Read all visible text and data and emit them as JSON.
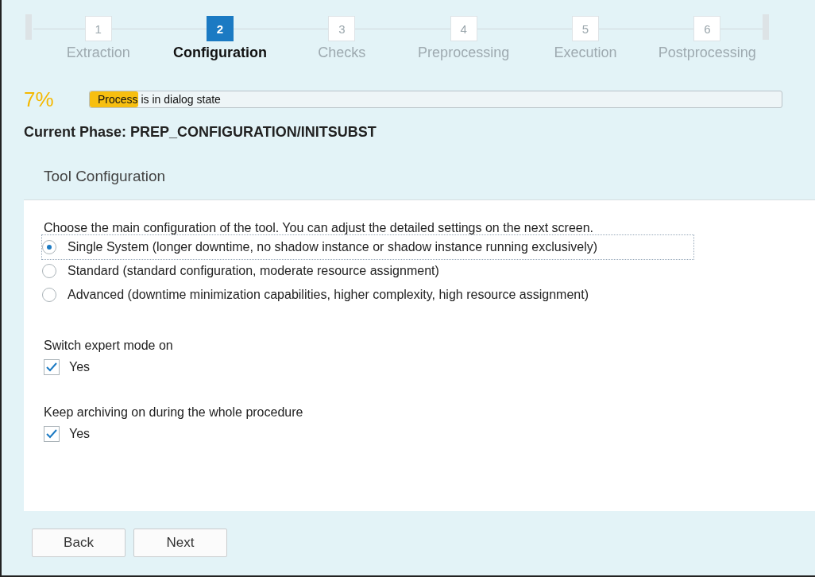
{
  "steps": [
    {
      "number": "1",
      "label": "Extraction",
      "selected": false
    },
    {
      "number": "2",
      "label": "Configuration",
      "selected": true
    },
    {
      "number": "3",
      "label": "Checks",
      "selected": false
    },
    {
      "number": "4",
      "label": "Preprocessing",
      "selected": false
    },
    {
      "number": "5",
      "label": "Execution",
      "selected": false
    },
    {
      "number": "6",
      "label": "Postprocessing",
      "selected": false
    }
  ],
  "progress": {
    "percent": "7%",
    "level": 0.07,
    "message": "Process is in dialog state"
  },
  "current_phase": "Current Phase: PREP_CONFIGURATION/INITSUBST",
  "section_title": "Tool Configuration",
  "intro": "Choose the main configuration of the tool. You can adjust the detailed settings on the next screen.",
  "options": [
    {
      "label": "Single System (longer downtime, no shadow instance or shadow instance running exclusively)",
      "selected": true
    },
    {
      "label": "Standard (standard configuration, moderate resource assignment)",
      "selected": false
    },
    {
      "label": "Advanced (downtime minimization capabilities, higher complexity, high resource assignment)",
      "selected": false
    }
  ],
  "settings": [
    {
      "title": "Switch expert mode on",
      "label": "Yes",
      "checked": true
    },
    {
      "title": "Keep archiving on during the whole procedure",
      "label": "Yes",
      "checked": true
    }
  ],
  "buttons": [
    "Back",
    "Next"
  ]
}
